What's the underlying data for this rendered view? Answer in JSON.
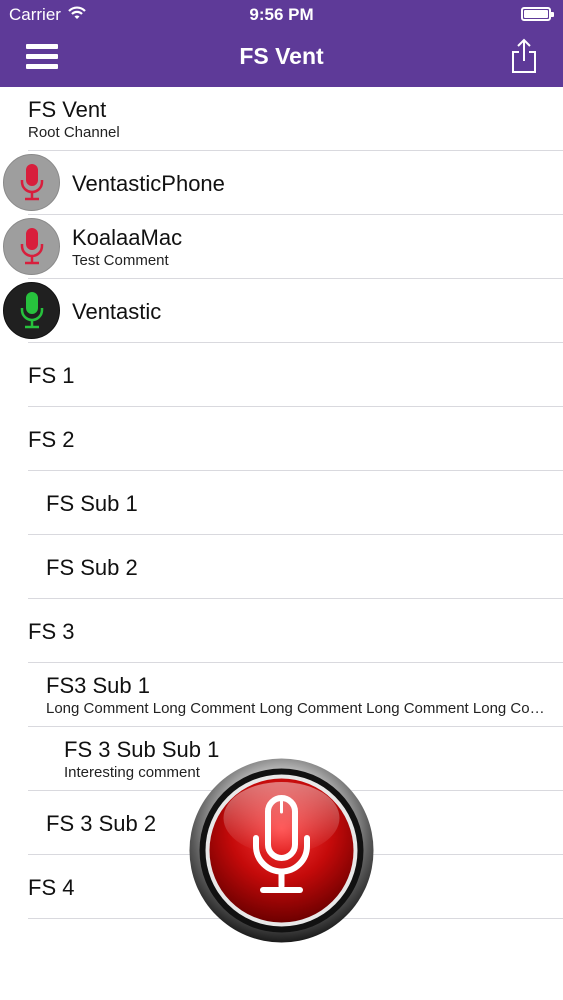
{
  "status_bar": {
    "carrier": "Carrier",
    "time": "9:56 PM"
  },
  "navbar": {
    "title": "FS Vent",
    "left_icon": "hamburger-menu-icon",
    "right_icon": "share-icon",
    "background": "#5e3a98"
  },
  "rows": {
    "root": {
      "title": "FS Vent",
      "subtitle": "Root Channel"
    },
    "user1": {
      "title": "VentasticPhone",
      "mic": "red",
      "avatar": "grey"
    },
    "user2": {
      "title": "KoalaaMac",
      "subtitle": "Test Comment",
      "mic": "red",
      "avatar": "grey"
    },
    "user3": {
      "title": "Ventastic",
      "mic": "green",
      "avatar": "dark"
    },
    "fs1": {
      "title": "FS 1"
    },
    "fs2": {
      "title": "FS 2"
    },
    "fs_sub1": {
      "title": "FS Sub 1"
    },
    "fs_sub2": {
      "title": "FS Sub 2"
    },
    "fs3": {
      "title": "FS 3"
    },
    "fs3_sub1": {
      "title": "FS3 Sub 1",
      "subtitle": "Long Comment Long Comment Long Comment Long Comment Long Comment"
    },
    "fs3_subsub1": {
      "title": "FS 3 Sub Sub 1",
      "subtitle": "Interesting comment"
    },
    "fs3_sub2": {
      "title": "FS 3 Sub 2"
    },
    "fs4": {
      "title": "FS 4"
    }
  },
  "colors": {
    "mic_red": "#d81e3c",
    "mic_green": "#27c23d",
    "ptt_red": "#c40a0a",
    "separator": "#d9d9de"
  },
  "ptt_button": {
    "icon": "microphone-icon"
  }
}
